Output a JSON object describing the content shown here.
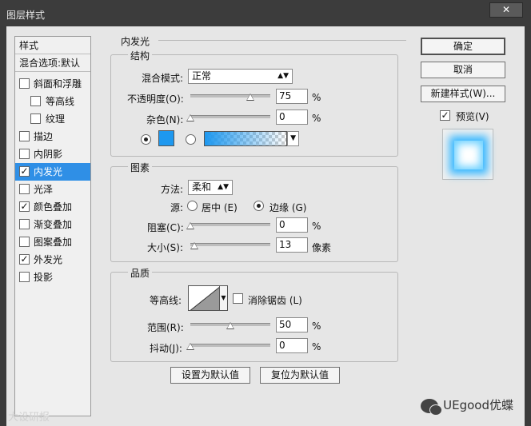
{
  "window": {
    "title": "图层样式",
    "close": "✕"
  },
  "sidebar": {
    "header": "样式",
    "blend_options": "混合选项:默认",
    "items": [
      {
        "label": "斜面和浮雕",
        "checked": false,
        "indent": false
      },
      {
        "label": "等高线",
        "checked": false,
        "indent": true
      },
      {
        "label": "纹理",
        "checked": false,
        "indent": true
      },
      {
        "label": "描边",
        "checked": false,
        "indent": false
      },
      {
        "label": "内阴影",
        "checked": false,
        "indent": false
      },
      {
        "label": "内发光",
        "checked": true,
        "indent": false,
        "selected": true
      },
      {
        "label": "光泽",
        "checked": false,
        "indent": false
      },
      {
        "label": "颜色叠加",
        "checked": true,
        "indent": false
      },
      {
        "label": "渐变叠加",
        "checked": false,
        "indent": false
      },
      {
        "label": "图案叠加",
        "checked": false,
        "indent": false
      },
      {
        "label": "外发光",
        "checked": true,
        "indent": false
      },
      {
        "label": "投影",
        "checked": false,
        "indent": false
      }
    ],
    "check_glyph": "✓"
  },
  "main": {
    "section_title": "内发光",
    "structure": {
      "title": "结构",
      "blend_mode_label": "混合模式:",
      "blend_mode_value": "正常",
      "opacity_label": "不透明度(O):",
      "opacity_value": "75",
      "opacity_unit": "%",
      "opacity_fraction": 0.75,
      "noise_label": "杂色(N):",
      "noise_value": "0",
      "noise_unit": "%",
      "noise_fraction": 0,
      "color_hex": "#1e98ef"
    },
    "elements": {
      "title": "图素",
      "method_label": "方法:",
      "method_value": "柔和",
      "source_label": "源:",
      "source_center": "居中 (E)",
      "source_edge": "边缘 (G)",
      "choke_label": "阻塞(C):",
      "choke_value": "0",
      "choke_unit": "%",
      "choke_fraction": 0,
      "size_label": "大小(S):",
      "size_value": "13",
      "size_unit": "像素",
      "size_fraction": 0.05
    },
    "quality": {
      "title": "品质",
      "contour_label": "等高线:",
      "antialias_label": "消除锯齿 (L)",
      "range_label": "范围(R):",
      "range_value": "50",
      "range_unit": "%",
      "range_fraction": 0.5,
      "jitter_label": "抖动(J):",
      "jitter_value": "0",
      "jitter_unit": "%",
      "jitter_fraction": 0
    },
    "buttons": {
      "set_default": "设置为默认值",
      "reset_default": "复位为默认值"
    }
  },
  "right": {
    "ok": "确定",
    "cancel": "取消",
    "new_style": "新建样式(W)...",
    "preview_label": "预览(V)",
    "preview_checked": true
  },
  "watermarks": {
    "bottom_left": "大设研报",
    "wechat": "UEgood优蝶"
  },
  "icons": {
    "dropdown": "dropdown-arrow-icon",
    "check": "check-icon",
    "wechat": "wechat-icon"
  }
}
